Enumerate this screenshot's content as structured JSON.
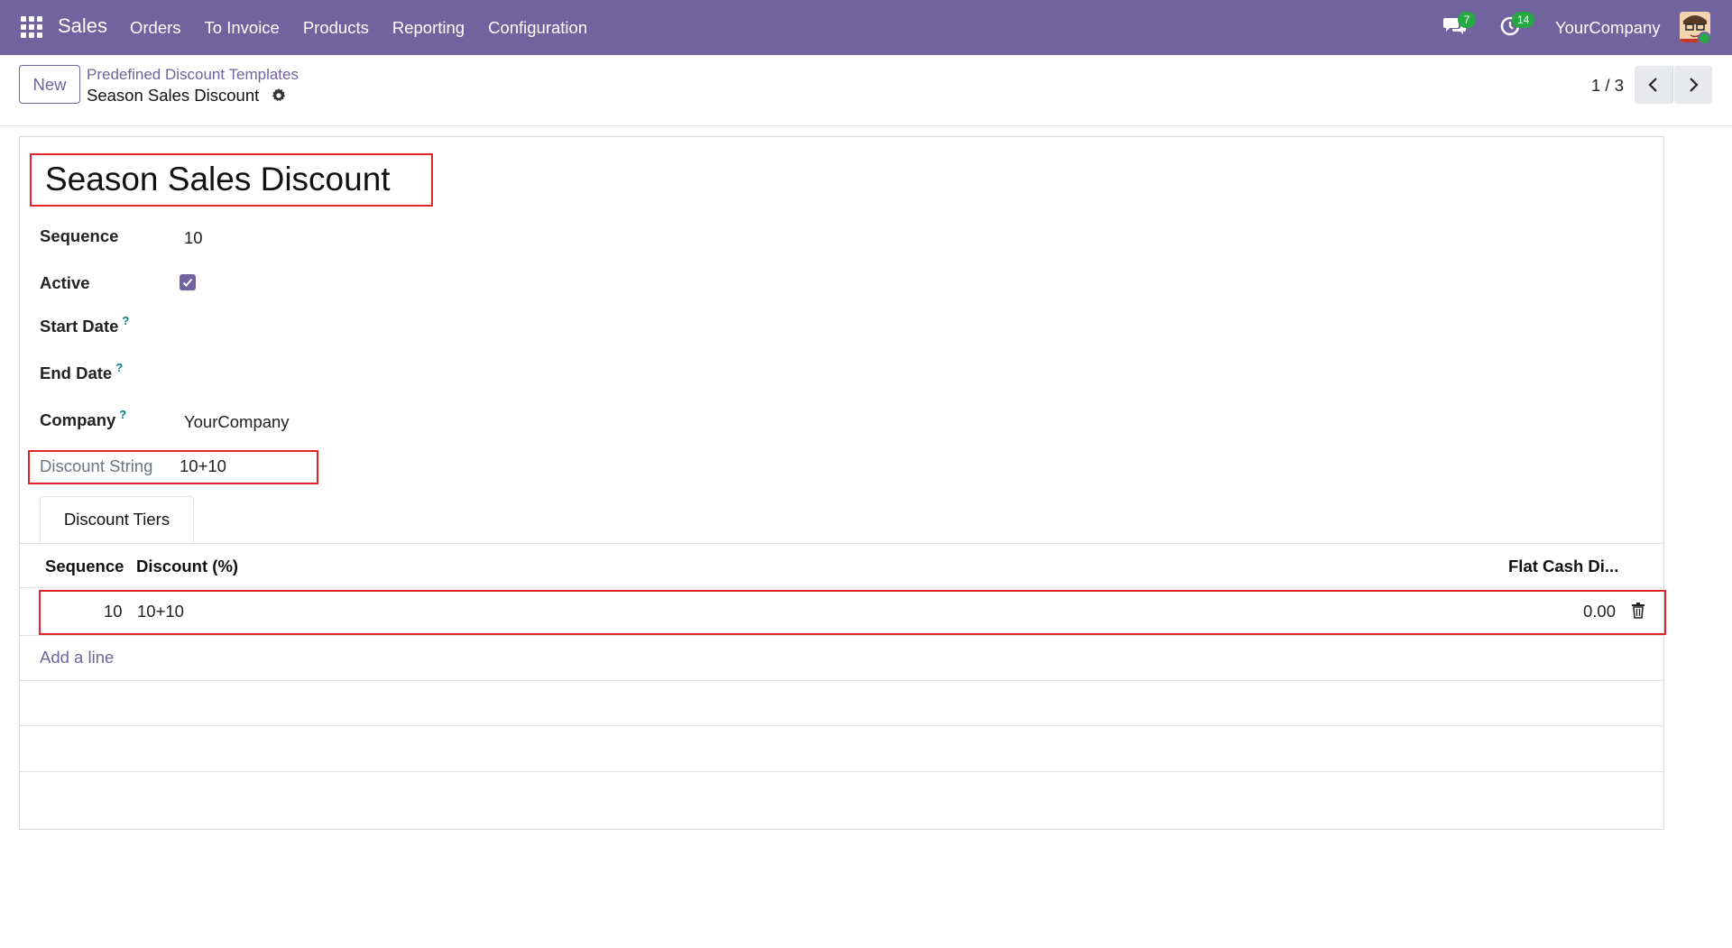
{
  "topbar": {
    "app_name": "Sales",
    "menu": [
      "Orders",
      "To Invoice",
      "Products",
      "Reporting",
      "Configuration"
    ],
    "messages_count": "7",
    "activities_count": "14",
    "company": "YourCompany",
    "accent_color": "#71639e",
    "badge_color": "#28a745"
  },
  "control": {
    "new_label": "New",
    "breadcrumb_parent": "Predefined Discount Templates",
    "record_name": "Season Sales Discount",
    "pager": "1 / 3"
  },
  "form": {
    "title": "Season Sales Discount",
    "fields": {
      "sequence": {
        "label": "Sequence",
        "value": "10"
      },
      "active": {
        "label": "Active",
        "checked": true
      },
      "start_date": {
        "label": "Start Date",
        "help": "?",
        "value": ""
      },
      "end_date": {
        "label": "End Date",
        "help": "?",
        "value": ""
      },
      "company": {
        "label": "Company",
        "help": "?",
        "value": "YourCompany"
      },
      "discount_string": {
        "label": "Discount String",
        "value": "10+10"
      }
    },
    "tab_label": "Discount Tiers",
    "table": {
      "columns": [
        "Sequence",
        "Discount (%)",
        "Flat Cash Di..."
      ],
      "rows": [
        {
          "sequence": "10",
          "discount": "10+10",
          "flat_cash": "0.00"
        }
      ],
      "add_line": "Add a line"
    },
    "highlight_color": "#e3242b"
  }
}
